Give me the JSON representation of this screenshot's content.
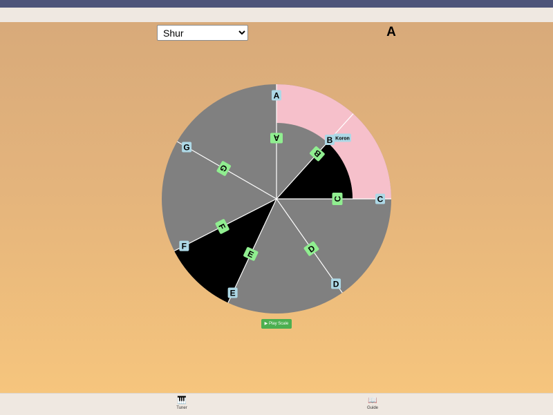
{
  "header": {
    "mode_options": [
      "Shur"
    ],
    "selected_mode": "Shur",
    "current_note": "A"
  },
  "wheel": {
    "outer_labels": [
      {
        "name": "A",
        "angle": 0
      },
      {
        "name": "B",
        "angle": 42,
        "accidental": "Koron"
      },
      {
        "name": "C",
        "angle": 90
      },
      {
        "name": "D",
        "angle": 145
      },
      {
        "name": "E",
        "angle": 205
      },
      {
        "name": "F",
        "angle": 243
      },
      {
        "name": "G",
        "angle": 300
      }
    ],
    "inner_labels": [
      {
        "name": "A",
        "angle": 0
      },
      {
        "name": "B",
        "angle": 42
      },
      {
        "name": "C",
        "angle": 90
      },
      {
        "name": "D",
        "angle": 145
      },
      {
        "name": "E",
        "angle": 205
      },
      {
        "name": "F",
        "angle": 243
      },
      {
        "name": "G",
        "angle": 300
      }
    ],
    "colors": {
      "base": "#808080",
      "highlight": "#f6c0cb",
      "dark": "#000000",
      "outer_label_bg": "#add8e6",
      "inner_label_bg": "#90ee90"
    }
  },
  "actions": {
    "play_label": "▶ Play Scale"
  },
  "nav": {
    "items": [
      {
        "label": "Tuner",
        "icon": "piano-icon"
      },
      {
        "label": "Guide",
        "icon": "book-icon"
      }
    ]
  }
}
